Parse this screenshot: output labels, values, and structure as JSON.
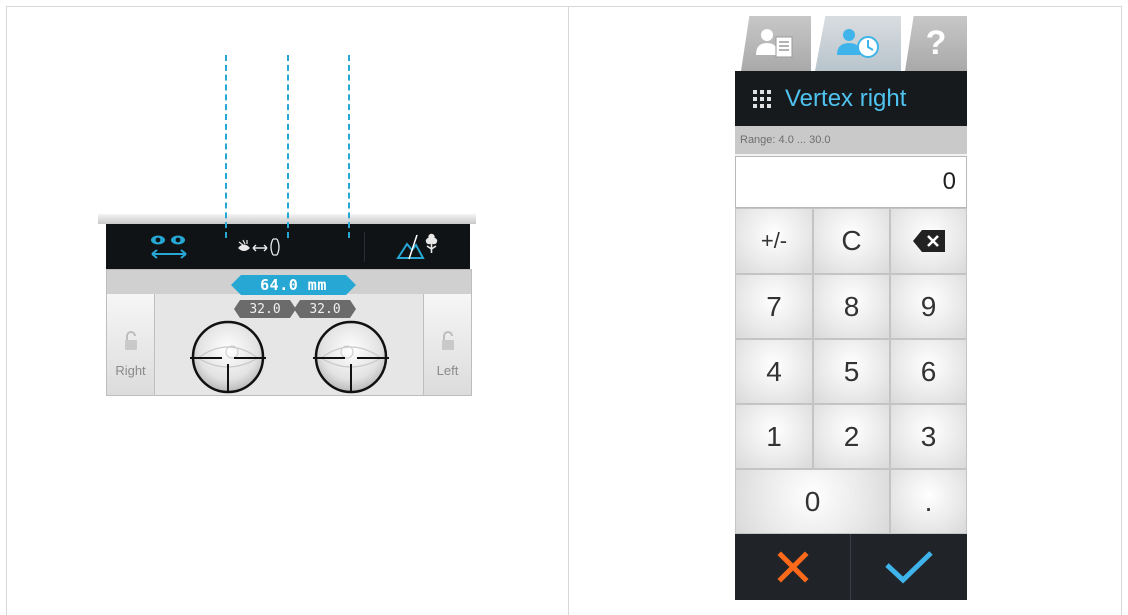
{
  "pd_panel": {
    "toolbar": {
      "binocular_icon": "eyes-binocular-icon",
      "distance_icon": "eye-distance-icon",
      "mode_icon": "mountain-flower-icon"
    },
    "total_pd": "64.0 mm",
    "right_half": "32.0",
    "left_half": "32.0",
    "right_label": "Right",
    "left_label": "Left",
    "accent_color": "#27a7d3"
  },
  "keypad": {
    "tabs": [
      {
        "icon": "patient-record-icon"
      },
      {
        "icon": "patient-history-icon"
      },
      {
        "label": "?"
      }
    ],
    "title": "Vertex right",
    "range": "Range: 4.0 ... 30.0",
    "display_value": "0",
    "keys": {
      "sign": "+/-",
      "clear": "C",
      "backspace_icon": "backspace-icon",
      "digits": [
        "7",
        "8",
        "9",
        "4",
        "5",
        "6",
        "1",
        "2",
        "3",
        "0"
      ],
      "decimal": "."
    },
    "cancel_color": "#ff6a1a",
    "ok_color": "#3fb4ea"
  }
}
